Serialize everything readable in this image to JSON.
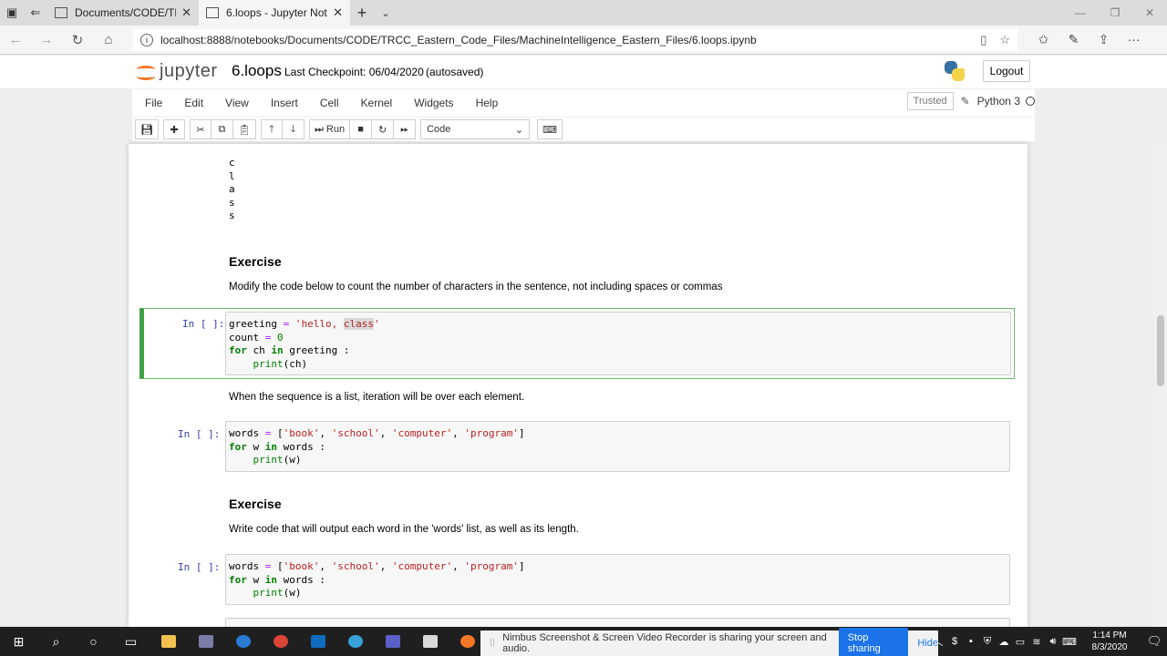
{
  "browser": {
    "tabs": [
      {
        "title": "Documents/CODE/TRCC_Ea",
        "active": false
      },
      {
        "title": "6.loops - Jupyter Noteb",
        "active": true
      }
    ],
    "url": "localhost:8888/notebooks/Documents/CODE/TRCC_Eastern_Code_Files/MachineIntelligence_Eastern_Files/6.loops.ipynb"
  },
  "jupyter": {
    "logo_text": "jupyter",
    "notebook_name": "6.loops",
    "checkpoint": "Last Checkpoint: 06/04/2020",
    "autosave": "(autosaved)",
    "logout_label": "Logout",
    "menu": [
      "File",
      "Edit",
      "View",
      "Insert",
      "Cell",
      "Kernel",
      "Widgets",
      "Help"
    ],
    "trusted_label": "Trusted",
    "kernel_name": "Python 3",
    "toolbar": {
      "run_label": "Run",
      "cell_type": "Code"
    }
  },
  "notebook": {
    "output_chars": [
      "c",
      "l",
      "a",
      "s",
      "s"
    ],
    "exercise1_heading": "Exercise",
    "exercise1_text": "Modify the code below to count the number of characters in the sentence, not including spaces or commas",
    "prompt": "In [ ]:",
    "list_text": "When the sequence is a list, iteration will be over each element.",
    "exercise2_heading": "Exercise",
    "exercise2_text": "Write code that will output each word in the 'words' list, as well as its length."
  },
  "taskbar": {
    "share_message": "Nimbus Screenshot & Screen Video Recorder is sharing your screen and audio.",
    "stop_label": "Stop sharing",
    "hide_label": "Hide",
    "time": "1:14 PM",
    "date": "8/3/2020"
  }
}
